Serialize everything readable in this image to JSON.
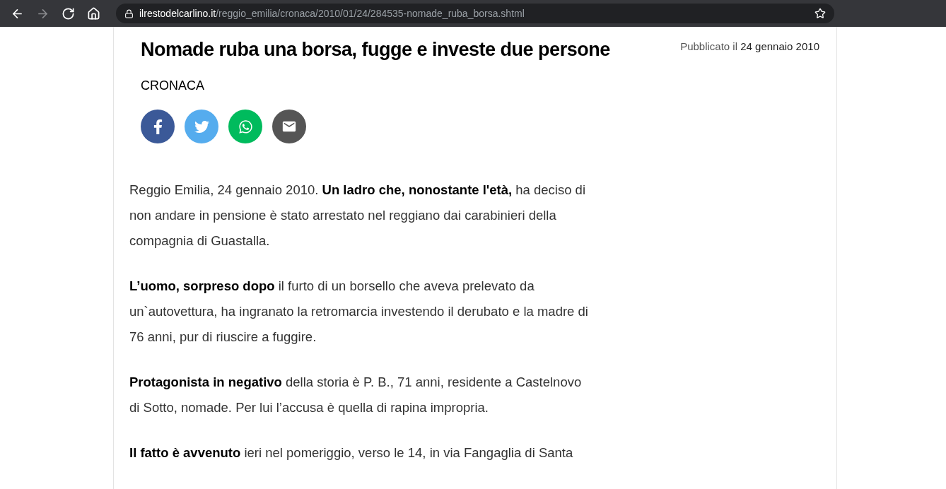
{
  "browser": {
    "nav": [
      {
        "kind": "back",
        "disabled": false
      },
      {
        "kind": "forward",
        "disabled": true
      },
      {
        "kind": "reload",
        "disabled": false
      },
      {
        "kind": "home",
        "disabled": false
      }
    ],
    "address": {
      "domain": "ilrestodelcarlino.it",
      "path": "/reggio_emilia/cronaca/2010/01/24/284535-nomade_ruba_borsa.shtml"
    }
  },
  "article": {
    "title": "Nomade ruba una borsa, fugge e investe due persone",
    "published_label": "Pubblicato il",
    "published_date": "24 gennaio 2010",
    "section": "CRONACA",
    "share": [
      {
        "kind": "facebook"
      },
      {
        "kind": "twitter"
      },
      {
        "kind": "whatsapp"
      },
      {
        "kind": "email"
      }
    ],
    "paragraphs": [
      "Reggio Emilia, 24 gennaio 2010. **Un ladro che, nonostante l'età,** ha deciso di non andare in pensione è stato arrestato nel reggiano dai carabinieri della compagnia di Guastalla.",
      "**L’uomo, sorpreso dopo** il furto di un borsello che aveva prelevato da un`autovettura, ha ingranato la retromarcia investendo il derubato e la madre di 76 anni, pur di riuscire a fuggire.",
      "**Protagonista in negativo** della storia è P. B., 71 anni, residente a Castelnovo di Sotto, nomade. Per lui l’accusa è quella di rapina impropria.",
      "**Il fatto è avvenuto** ieri nel pomeriggio, verso le 14, in via Fangaglia di Santa"
    ]
  }
}
